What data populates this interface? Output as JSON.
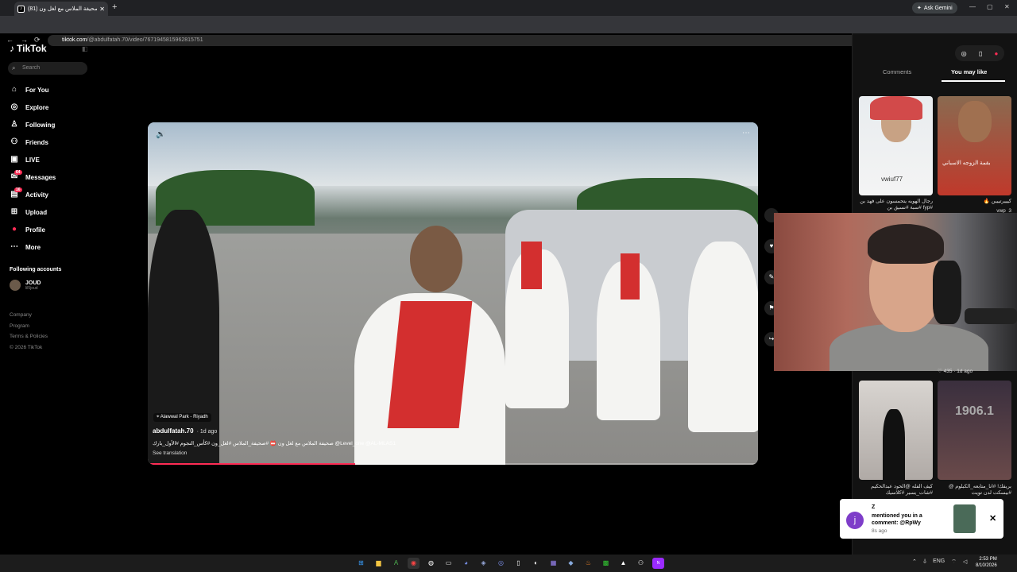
{
  "browser": {
    "tab_title": "(81) صحيفة الملاس مع لغل ون",
    "tab_close": "✕",
    "new_tab": "+",
    "ask_gemini": "Ask Gemini",
    "url_host": "tiktok.com",
    "url_path": "/@abdulfatah.70/video/7671945815962815751",
    "win_min": "—",
    "win_max": "▢",
    "win_close": "✕",
    "nav_back": "←",
    "nav_forward": "→",
    "nav_reload": "⟳"
  },
  "sidebar": {
    "logo": "TikTok",
    "search_placeholder": "Search",
    "items": [
      {
        "label": "For You",
        "icon": "⌂"
      },
      {
        "label": "Explore",
        "icon": "◎"
      },
      {
        "label": "Following",
        "icon": "♙"
      },
      {
        "label": "Friends",
        "icon": "⚇"
      },
      {
        "label": "LIVE",
        "icon": "▣"
      },
      {
        "label": "Messages",
        "icon": "✉",
        "badge": "64"
      },
      {
        "label": "Activity",
        "icon": "▤",
        "badge": "16"
      },
      {
        "label": "Upload",
        "icon": "⊞"
      },
      {
        "label": "Profile",
        "icon": "●"
      },
      {
        "label": "More",
        "icon": "⋯"
      }
    ],
    "following_header": "Following accounts",
    "account_name": "JOUD",
    "account_handle": "lil5joud",
    "footer": [
      "Company",
      "Program",
      "Terms & Policies",
      "© 2026 TikTok"
    ]
  },
  "video": {
    "location": "Alawwal Park - Riyadh",
    "username": "abdulfatah.70",
    "time_ago": "· 1d ago",
    "caption": "صحيفة الملاس مع لغل ون 📛 #صحيفة_الملاس #لغل_ون #كأس_النجوم #الأول_بارك @Level_one @AL-MLAS1",
    "see_translation": "See translation",
    "progress_fraction": 0.34
  },
  "right_panel": {
    "tab_comments": "Comments",
    "tab_you_may_like": "You may like",
    "thumb1_overlay": "vwiuf77",
    "thumb1_caption": "رجال الهويه يتحمسون على فهد بن #fyp #سبة #نسيق بن",
    "thumb2_caption": "كيييرتييين 🔥",
    "thumb2_overlay": "بقمة الزوجه الاسباني",
    "thumb4_overlay": "1906.1",
    "thumb3_caption": "كيف الفله @الحود عبدالحكيم #شات_يسير #كلاسيك",
    "thumb4_caption": "بريقك! #انا_متابعه_الكبلوم @ #بيسكت لدن تويت",
    "thumb2_sub": "vwp_3",
    "views": "♡ 435 · 1d ago"
  },
  "notification": {
    "avatar_letter": "j",
    "title": "Z",
    "body": "mentioned you in a comment: @RpWy",
    "time": "8s ago",
    "close": "✕"
  },
  "taskbar": {
    "lang": "ENG",
    "time": "2:53 PM",
    "date": "8/10/2026"
  },
  "colors": {
    "accent": "#fe2c55",
    "bg": "#000000",
    "panel": "#121212"
  }
}
